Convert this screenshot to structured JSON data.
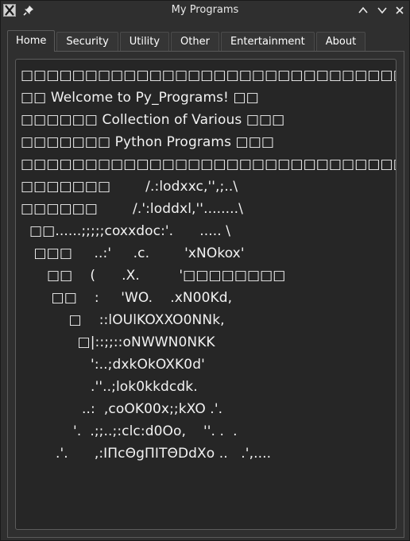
{
  "window": {
    "title": "My Programs",
    "icons": {
      "app": "x-app-icon",
      "pin": "pin-icon",
      "up": "chevron-up-icon",
      "down": "chevron-down-icon",
      "close": "close-icon"
    }
  },
  "tabs": [
    {
      "label": "Home",
      "active": true
    },
    {
      "label": "Security",
      "active": false
    },
    {
      "label": "Utility",
      "active": false
    },
    {
      "label": "Other",
      "active": false
    },
    {
      "label": "Entertainment",
      "active": false
    },
    {
      "label": "About",
      "active": false
    }
  ],
  "home": {
    "lines": [
      "□□□□□□□□□□□□□□□□□□□□□□□□□□□□□□□□□□□□□□□□□□□□□□",
      "□□ Welcome to Py_Programs! □□",
      "□□□□□□ Collection of Various □□□",
      "□□□□□□□ Python Programs □□□",
      "□□□□□□□□□□□□□□□□□□□□□□□□□□□□□□□□□□□□□",
      "□□□□□□□        /.:lodxxc,'',;..\\",
      "□□□□□□        /.':loddxl,''........\\",
      "  □□......;;;;;coxxdoc:'.      ..... \\",
      "   □□□     ..:'     .c.        'xNOkox'",
      "      □□    (      .X.         '□□□□□□□□",
      "       □□    :     'WO.    .xN00Kd,",
      "           □    ::lOUlKOXXO0NNk,",
      "             □|::;;::oNWWN0NKK",
      "                ':..;dxkOkOXK0d'",
      "                .''..;lok0kkdcdk.",
      "              ..:  ,coOK00x;;kXO .'.",
      "            '.  .;;..;:clc:d0Oo,    ''. .  .",
      "        .'.      ,:IΠcΘgΠITΘDdXo ..   .',...."
    ]
  }
}
